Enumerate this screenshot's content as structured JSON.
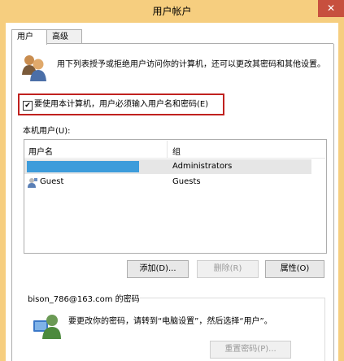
{
  "window": {
    "title": "用户帐户",
    "close_glyph": "✕"
  },
  "tabs": [
    {
      "label": "用户",
      "active": true
    },
    {
      "label": "高级",
      "active": false
    }
  ],
  "description": "用下列表授予或拒绝用户访问你的计算机，还可以更改其密码和其他设置。",
  "require_password": {
    "checked": true,
    "check_glyph": "✔",
    "label": "要使用本计算机，用户必须输入用户名和密码(E)"
  },
  "users_section": {
    "label": "本机用户(U):"
  },
  "users_table": {
    "headers": [
      "用户名",
      "组"
    ],
    "rows": [
      {
        "name": "",
        "group": "Administrators",
        "selected": true
      },
      {
        "name": "Guest",
        "group": "Guests",
        "selected": false
      }
    ]
  },
  "buttons": {
    "add": "添加(D)...",
    "remove": "删除(R)",
    "properties": "属性(O)",
    "reset_password": "重置密码(P)..."
  },
  "password_group": {
    "title": "bison_786@163.com 的密码",
    "note": "要更改你的密码，请转到“电脑设置”，然后选择“用户”。"
  },
  "colors": {
    "title_bar": "#f6ce7f",
    "close": "#c7503e",
    "highlight_box": "#c0211f",
    "selection": "#3d9cdb"
  },
  "icons": {
    "users": "users-icon",
    "guest": "guest-user-icon",
    "account": "user-account-icon"
  }
}
